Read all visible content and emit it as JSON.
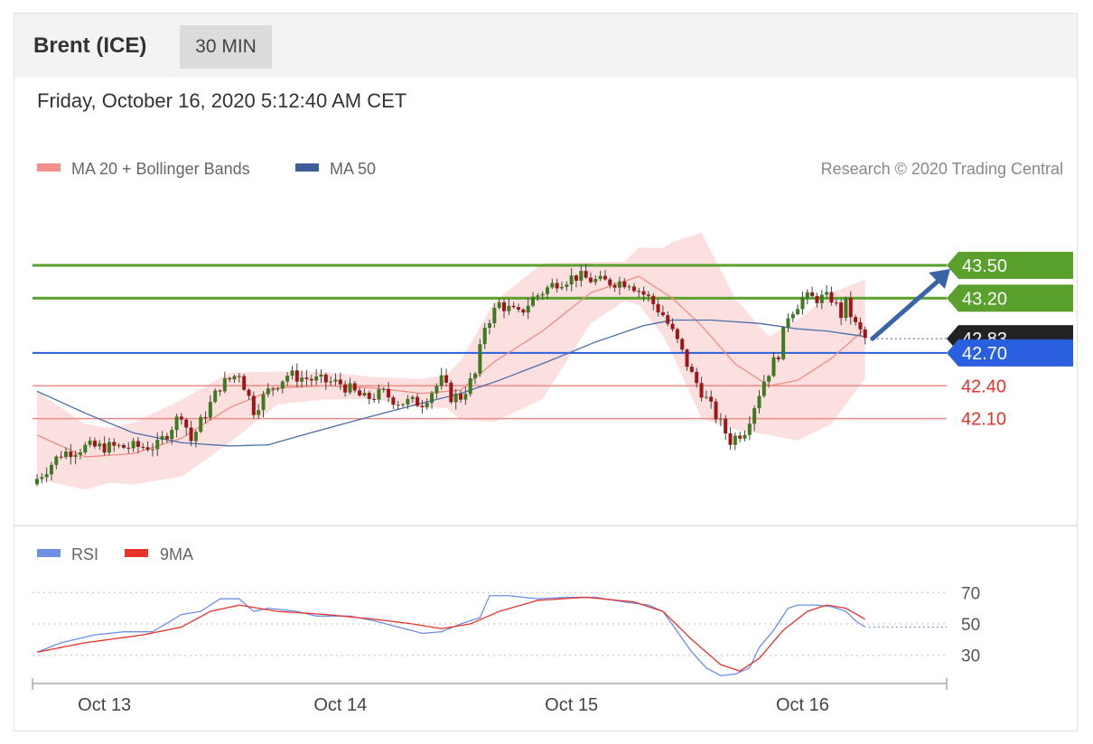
{
  "header": {
    "instrument": "Brent (ICE)",
    "timeframe": "30 MIN",
    "datetime": "Friday, October 16, 2020 5:12:40 AM CET"
  },
  "credit": "Research © 2020 Trading Central",
  "legend": {
    "bb": "MA 20 + Bollinger Bands",
    "ma50": "MA 50",
    "rsi": "RSI",
    "ma9": "9MA"
  },
  "colors": {
    "bullish": "#5aa02c",
    "pivot": "#2a5fe0",
    "bearish": "#e8332a",
    "last": "#222222",
    "bb_fill": "#fbdada",
    "ma20": "#f08c80",
    "ma50": "#4b6ea8",
    "rsi": "#6e8fe6",
    "rsi_ma": "#e8332a",
    "arrow": "#3a64a8"
  },
  "chart_data": [
    {
      "type": "candlestick",
      "title": "Brent (ICE)",
      "ylim": [
        41.28,
        43.78
      ],
      "x_ticks": [
        {
          "label": "Oct 13",
          "index": 14
        },
        {
          "label": "Oct 14",
          "index": 63
        },
        {
          "label": "Oct 15",
          "index": 111
        },
        {
          "label": "Oct 16",
          "index": 159
        }
      ],
      "levels": [
        {
          "label": "43.50",
          "value": 43.5,
          "kind": "resistance"
        },
        {
          "label": "43.20",
          "value": 43.2,
          "kind": "resistance"
        },
        {
          "label": "42.83",
          "value": 42.83,
          "kind": "last"
        },
        {
          "label": "42.70",
          "value": 42.7,
          "kind": "pivot"
        },
        {
          "label": "42.40",
          "value": 42.4,
          "kind": "support"
        },
        {
          "label": "42.10",
          "value": 42.1,
          "kind": "support"
        }
      ],
      "close_anchors": [
        [
          0,
          41.55
        ],
        [
          5,
          41.78
        ],
        [
          10,
          41.84
        ],
        [
          20,
          41.84
        ],
        [
          25,
          41.85
        ],
        [
          30,
          42.15
        ],
        [
          32,
          41.9
        ],
        [
          38,
          42.4
        ],
        [
          42,
          42.52
        ],
        [
          45,
          42.18
        ],
        [
          48,
          42.35
        ],
        [
          52,
          42.5
        ],
        [
          58,
          42.45
        ],
        [
          63,
          42.42
        ],
        [
          68,
          42.28
        ],
        [
          72,
          42.33
        ],
        [
          75,
          42.25
        ],
        [
          80,
          42.25
        ],
        [
          84,
          42.45
        ],
        [
          86,
          42.3
        ],
        [
          88,
          42.3
        ],
        [
          91,
          42.5
        ],
        [
          93,
          42.95
        ],
        [
          96,
          43.15
        ],
        [
          100,
          43.05
        ],
        [
          103,
          43.2
        ],
        [
          108,
          43.35
        ],
        [
          112,
          43.4
        ],
        [
          117,
          43.35
        ],
        [
          123,
          43.35
        ],
        [
          127,
          43.2
        ],
        [
          130,
          43.05
        ],
        [
          133,
          42.8
        ],
        [
          136,
          42.5
        ],
        [
          140,
          42.2
        ],
        [
          144,
          41.9
        ],
        [
          147,
          42.0
        ],
        [
          151,
          42.45
        ],
        [
          154,
          42.7
        ],
        [
          156,
          43.05
        ],
        [
          159,
          43.2
        ],
        [
          162,
          43.2
        ],
        [
          165,
          43.2
        ],
        [
          167,
          43.05
        ],
        [
          168,
          43.15
        ],
        [
          170,
          42.95
        ],
        [
          172,
          42.83
        ]
      ],
      "ma20_anchors": [
        [
          0,
          41.95
        ],
        [
          10,
          41.75
        ],
        [
          20,
          41.78
        ],
        [
          30,
          41.92
        ],
        [
          40,
          42.2
        ],
        [
          50,
          42.38
        ],
        [
          60,
          42.4
        ],
        [
          70,
          42.38
        ],
        [
          80,
          42.33
        ],
        [
          88,
          42.36
        ],
        [
          95,
          42.62
        ],
        [
          105,
          42.9
        ],
        [
          115,
          43.25
        ],
        [
          125,
          43.4
        ],
        [
          132,
          43.2
        ],
        [
          138,
          42.95
        ],
        [
          145,
          42.6
        ],
        [
          152,
          42.4
        ],
        [
          158,
          42.45
        ],
        [
          165,
          42.65
        ],
        [
          172,
          42.92
        ]
      ],
      "ma50_anchors": [
        [
          0,
          42.35
        ],
        [
          10,
          42.15
        ],
        [
          20,
          41.97
        ],
        [
          30,
          41.88
        ],
        [
          40,
          41.85
        ],
        [
          48,
          41.86
        ],
        [
          56,
          41.96
        ],
        [
          66,
          42.08
        ],
        [
          78,
          42.22
        ],
        [
          88,
          42.33
        ],
        [
          96,
          42.45
        ],
        [
          106,
          42.62
        ],
        [
          116,
          42.8
        ],
        [
          126,
          42.95
        ],
        [
          132,
          43.0
        ],
        [
          140,
          43.0
        ],
        [
          150,
          42.97
        ],
        [
          158,
          42.92
        ],
        [
          164,
          42.9
        ],
        [
          172,
          42.85
        ]
      ],
      "bb_width_anchors": [
        [
          0,
          0.4
        ],
        [
          15,
          0.25
        ],
        [
          30,
          0.35
        ],
        [
          40,
          0.32
        ],
        [
          50,
          0.15
        ],
        [
          70,
          0.1
        ],
        [
          85,
          0.15
        ],
        [
          95,
          0.55
        ],
        [
          105,
          0.62
        ],
        [
          115,
          0.28
        ],
        [
          122,
          0.18
        ],
        [
          130,
          0.4
        ],
        [
          138,
          0.85
        ],
        [
          145,
          0.6
        ],
        [
          152,
          0.45
        ],
        [
          158,
          0.55
        ],
        [
          165,
          0.6
        ],
        [
          172,
          0.45
        ]
      ],
      "forecast": {
        "from": 42.83,
        "to": 43.5
      }
    },
    {
      "type": "line",
      "title": "RSI",
      "ylim": [
        12,
        88
      ],
      "y_ticks": [
        "70",
        "50",
        "30"
      ],
      "series": [
        {
          "name": "RSI",
          "anchors": [
            [
              0,
              32
            ],
            [
              5,
              38
            ],
            [
              12,
              43
            ],
            [
              18,
              45
            ],
            [
              24,
              45
            ],
            [
              30,
              56
            ],
            [
              34,
              58
            ],
            [
              38,
              66
            ],
            [
              42,
              66
            ],
            [
              45,
              58
            ],
            [
              48,
              60
            ],
            [
              54,
              58
            ],
            [
              58,
              55
            ],
            [
              65,
              55
            ],
            [
              70,
              52
            ],
            [
              75,
              48
            ],
            [
              80,
              44
            ],
            [
              84,
              45
            ],
            [
              88,
              50
            ],
            [
              92,
              54
            ],
            [
              94,
              68
            ],
            [
              98,
              68
            ],
            [
              104,
              66
            ],
            [
              110,
              67
            ],
            [
              116,
              67
            ],
            [
              122,
              64
            ],
            [
              127,
              62
            ],
            [
              130,
              58
            ],
            [
              133,
              45
            ],
            [
              136,
              32
            ],
            [
              139,
              22
            ],
            [
              142,
              17
            ],
            [
              145,
              18
            ],
            [
              148,
              22
            ],
            [
              150,
              35
            ],
            [
              153,
              46
            ],
            [
              156,
              60
            ],
            [
              158,
              62
            ],
            [
              162,
              62
            ],
            [
              165,
              61
            ],
            [
              168,
              58
            ],
            [
              170,
              52
            ],
            [
              172,
              48
            ]
          ]
        },
        {
          "name": "9MA",
          "anchors": [
            [
              0,
              32
            ],
            [
              10,
              38
            ],
            [
              22,
              43
            ],
            [
              30,
              48
            ],
            [
              36,
              58
            ],
            [
              42,
              62
            ],
            [
              50,
              58
            ],
            [
              60,
              56
            ],
            [
              70,
              53
            ],
            [
              78,
              50
            ],
            [
              84,
              47
            ],
            [
              90,
              50
            ],
            [
              96,
              58
            ],
            [
              104,
              65
            ],
            [
              114,
              67
            ],
            [
              124,
              64
            ],
            [
              130,
              58
            ],
            [
              136,
              40
            ],
            [
              142,
              24
            ],
            [
              146,
              20
            ],
            [
              150,
              28
            ],
            [
              155,
              46
            ],
            [
              160,
              58
            ],
            [
              164,
              62
            ],
            [
              168,
              60
            ],
            [
              172,
              53
            ]
          ]
        }
      ]
    }
  ]
}
